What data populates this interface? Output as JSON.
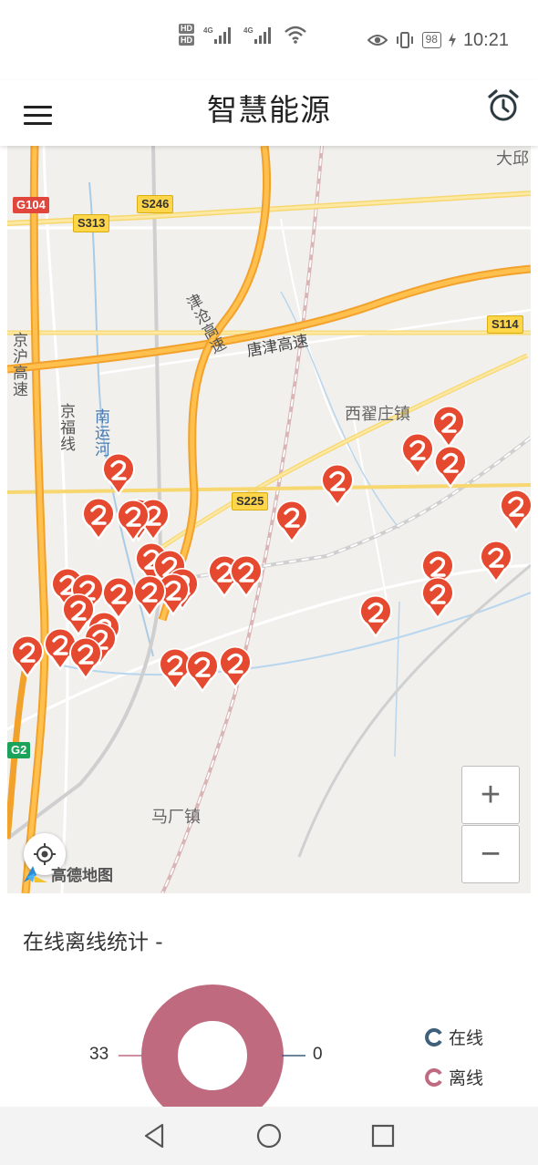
{
  "status_bar": {
    "hd1": "HD",
    "hd2": "HD",
    "net1": "4G",
    "net2": "4G",
    "battery": "98",
    "time": "10:21"
  },
  "header": {
    "title": "智慧能源",
    "menu_icon": "hamburger-menu-icon",
    "alarm_icon": "alarm-clock-icon"
  },
  "map": {
    "place_labels": [
      "西翟庄镇",
      "马厂镇",
      "大邱"
    ],
    "road_labels": [
      "津沧高速",
      "唐津高速",
      "南运河",
      "京福线",
      "京沪高速"
    ],
    "route_shields": [
      {
        "text": "G104",
        "color": "#e0463b"
      },
      {
        "text": "S313",
        "color": "#ffd54a"
      },
      {
        "text": "S246",
        "color": "#ffd54a"
      },
      {
        "text": "S114",
        "color": "#ffd54a"
      },
      {
        "text": "S225",
        "color": "#ffd54a"
      },
      {
        "text": "G2",
        "color": "#1ba35a"
      }
    ],
    "zoom_in": "+",
    "zoom_out": "−",
    "brand": "高德地图",
    "pin_color": "#e5492f"
  },
  "stats": {
    "title": "在线离线统计 -",
    "online_value": "0",
    "offline_value": "33",
    "legend": [
      {
        "label": "在线",
        "color": "#3f5f7a"
      },
      {
        "label": "离线",
        "color": "#c06a80"
      }
    ]
  },
  "nav_bar": {
    "back_icon": "back-triangle-icon",
    "home_icon": "home-circle-icon",
    "recents_icon": "recents-square-icon"
  }
}
